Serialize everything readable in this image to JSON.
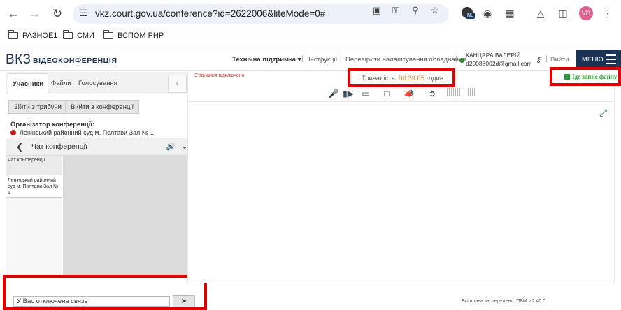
{
  "browser": {
    "url": "vkz.court.gov.ua/conference?id=2622006&liteMode=0#",
    "profile_initials": "VD",
    "extension_badge": "NL",
    "bookmarks": [
      {
        "label": "РАЗНОЕ1"
      },
      {
        "label": "СМИ"
      },
      {
        "label": "ВСПОМ PHP"
      }
    ]
  },
  "header": {
    "logo": "ВКЗ",
    "logo_sub": "ВІДЕОКОНФЕРЕНЦІЯ",
    "support": "Технічна підтримка",
    "instructions": "Інструкції",
    "check_settings": "Перевірити налаштування обладнання",
    "user_name": "КАНЦАРА ВАЛЕРІЙ",
    "user_email": "d20088002d@gmail.com",
    "exit": "Вийти",
    "menu": "МЕНЮ",
    "separator": "|"
  },
  "left_panel": {
    "tabs": [
      {
        "label": "Учасники",
        "active": true
      },
      {
        "label": "Файли",
        "active": false
      },
      {
        "label": "Голосування",
        "active": false
      }
    ],
    "leave_tribune": "Зійти з трибуни",
    "leave_conference": "Вийти з конференції",
    "organizer_label": "Організатор конференції:",
    "organizer_name": "Ленінський районний суд м. Полтави Зал № 1"
  },
  "chat": {
    "title": "Чат конференції",
    "list_header": "Чат конференції",
    "list_item": "Ленінський районний суд м. Полтави Зал № 1",
    "input_value": "У Вас отключена связь"
  },
  "video": {
    "connection_lost": "З'єднання відключено",
    "duration_label": "Тривалість:",
    "duration_value": "00:39:05",
    "duration_unit": "годин.",
    "recording_status": "Іде запис файлу"
  },
  "footer": {
    "copyright": "Всі права застережено. ПБМ v.2.40.0"
  },
  "colors": {
    "brand": "#1a3354",
    "highlight": "#e00000",
    "recording": "#2e9a3a",
    "online": "#2e8b2e",
    "offline": "#d01818",
    "duration": "#e88a1a"
  }
}
